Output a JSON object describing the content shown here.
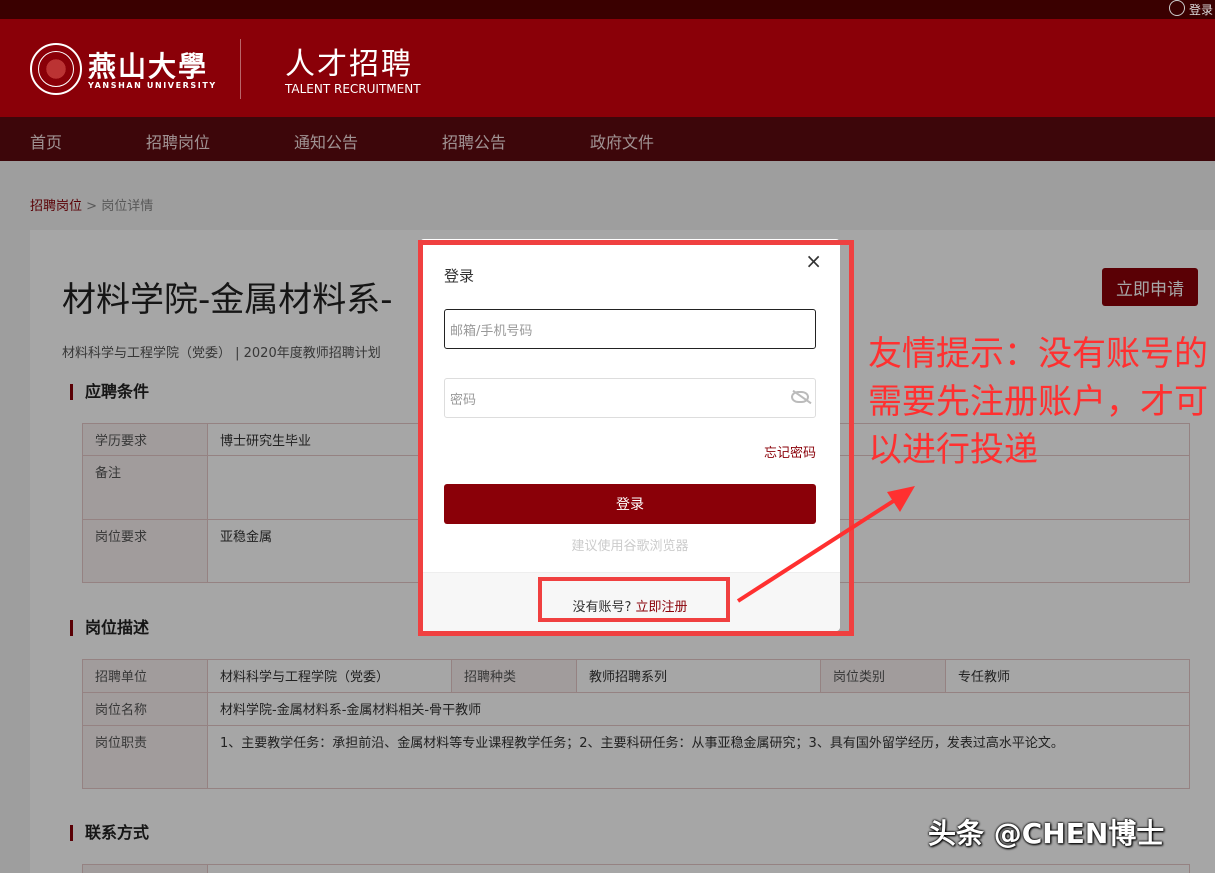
{
  "topbar": {
    "login_label": "登录"
  },
  "header": {
    "logo_cn": "燕山大學",
    "logo_en": "YANSHAN UNIVERSITY",
    "site_title": "人才招聘",
    "site_subtitle": "TALENT RECRUITMENT"
  },
  "nav": {
    "items": [
      "首页",
      "招聘岗位",
      "通知公告",
      "招聘公告",
      "政府文件"
    ]
  },
  "breadcrumb": {
    "parent": "招聘岗位",
    "separator": ">",
    "current": "岗位详情"
  },
  "job": {
    "title": "材料学院-金属材料系-",
    "apply_label": "立即申请",
    "meta": "材料科学与工程学院（党委）  |  2020年度教师招聘计划"
  },
  "sections": {
    "requirements": {
      "title": "应聘条件",
      "rows": [
        {
          "label": "学历要求",
          "value": "博士研究生毕业"
        },
        {
          "label": "备注",
          "value": ""
        },
        {
          "label": "岗位要求",
          "value": "亚稳金属"
        }
      ]
    },
    "description": {
      "title": "岗位描述",
      "unit_label": "招聘单位",
      "unit_value": "材料科学与工程学院（党委）",
      "type_label": "招聘种类",
      "type_value": "教师招聘系列",
      "category_label": "岗位类别",
      "category_value": "专任教师",
      "name_label": "岗位名称",
      "name_value": "材料学院-金属材料系-金属材料相关-骨干教师",
      "duty_label": "岗位职责",
      "duty_value": "1、主要教学任务：承担前沿、金属材料等专业课程教学任务；2、主要科研任务：从事亚稳金属研究；3、具有国外留学经历，发表过高水平论文。"
    },
    "contact": {
      "title": "联系方式"
    }
  },
  "modal": {
    "title": "登录",
    "close": "×",
    "account_placeholder": "邮箱/手机号码",
    "password_placeholder": "密码",
    "forgot": "忘记密码",
    "submit": "登录",
    "hint": "建议使用谷歌浏览器",
    "no_account": "没有账号?",
    "register": "立即注册"
  },
  "annotation": {
    "tip": "友情提示：没有账号的需要先注册账户，才可以进行投递"
  },
  "watermark": "头条 @CHEN博士",
  "colors": {
    "brand": "#8a0008",
    "annotation": "#ff3030"
  }
}
